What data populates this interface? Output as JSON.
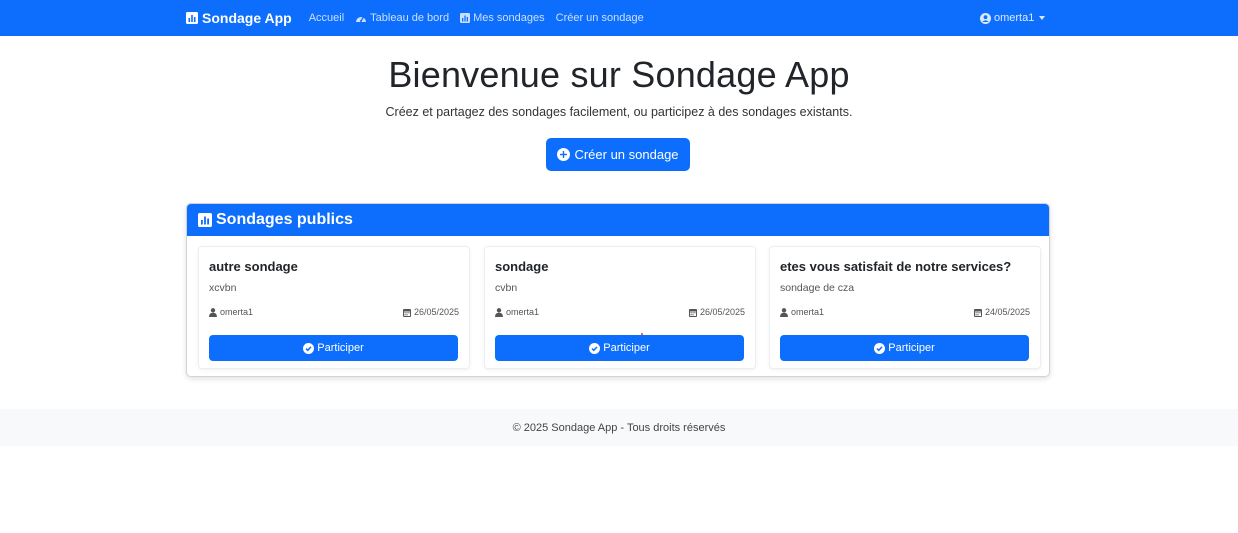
{
  "navbar": {
    "brand": "Sondage App",
    "links": [
      {
        "label": "Accueil",
        "icon": ""
      },
      {
        "label": "Tableau de bord",
        "icon": "gauge-icon"
      },
      {
        "label": "Mes sondages",
        "icon": "chart-icon"
      },
      {
        "label": "Créer un sondage",
        "icon": ""
      }
    ],
    "user": "omerta1"
  },
  "hero": {
    "title": "Bienvenue sur Sondage App",
    "subtitle": "Créez et partagez des sondages facilement, ou participez à des sondages existants.",
    "button": "Créer un sondage"
  },
  "panel": {
    "title": "Sondages publics",
    "cards": [
      {
        "title": "autre sondage",
        "description": "xcvbn",
        "author": "omerta1",
        "date": "26/05/2025",
        "button": "Participer"
      },
      {
        "title": "sondage",
        "description": "cvbn",
        "author": "omerta1",
        "date": "26/05/2025",
        "button": "Participer"
      },
      {
        "title": "etes vous satisfait de notre services?",
        "description": "sondage de cza",
        "author": "omerta1",
        "date": "24/05/2025",
        "button": "Participer"
      }
    ]
  },
  "footer": {
    "text": "© 2025 Sondage App - Tous droits réservés"
  },
  "colors": {
    "primary": "#0d6efd",
    "footer_bg": "#f8f9fa"
  }
}
